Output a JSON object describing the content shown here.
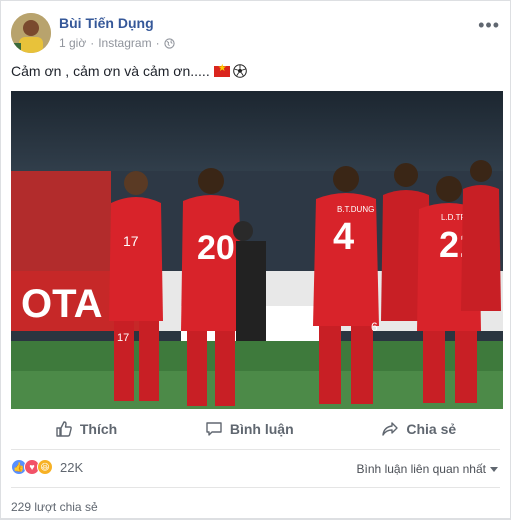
{
  "post": {
    "author": "Bùi Tiến Dụng",
    "time": "1 giờ",
    "separator": "·",
    "source": "Instagram",
    "more_label": "•••",
    "text": "Cảm ơn , cảm ơn và cảm ơn.....",
    "emoji": [
      "vietnam-flag",
      "soccer-ball"
    ]
  },
  "photo": {
    "jersey_numbers": [
      "17",
      "20",
      "4",
      "21",
      "6",
      "17"
    ],
    "jersey_names": [
      "B.T.DUNG",
      "L.D.TRONG"
    ]
  },
  "actions": {
    "like": "Thích",
    "comment": "Bình luận",
    "share": "Chia sẻ"
  },
  "stats": {
    "reaction_count": "22K",
    "reaction_types": [
      "like-icon",
      "love-icon",
      "haha-icon"
    ],
    "sort_label": "Bình luận liên quan nhất",
    "shares": "229 lượt chia sẻ"
  },
  "colors": {
    "name_blue": "#365899",
    "action_gray": "#606770",
    "jersey_red": "#d8232a"
  }
}
